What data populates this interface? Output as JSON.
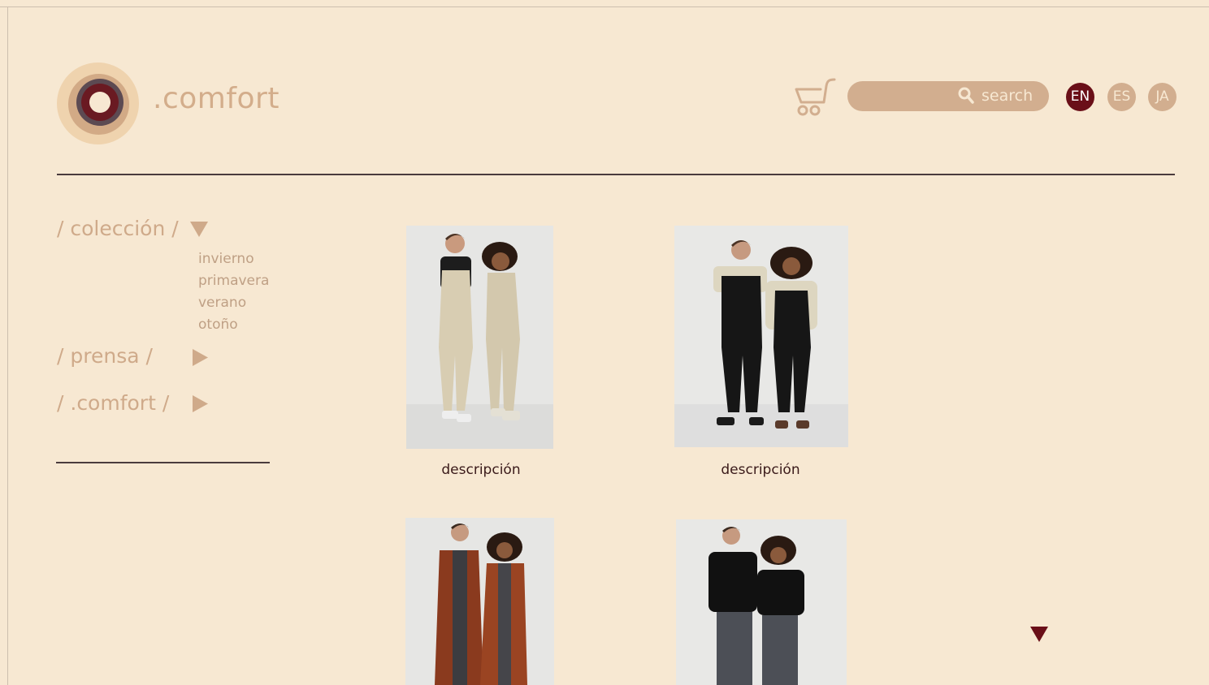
{
  "brand": {
    "name": ".comfort"
  },
  "header": {
    "search_placeholder": "search",
    "languages": [
      "EN",
      "ES",
      "JA"
    ],
    "active_language": "EN"
  },
  "nav": {
    "sections": [
      {
        "label": "/ colección /",
        "expanded": true,
        "items": [
          "invierno",
          "primavera",
          "verano",
          "otoño"
        ]
      },
      {
        "label": "/ prensa /",
        "expanded": false
      },
      {
        "label": "/ .comfort /",
        "expanded": false
      }
    ]
  },
  "products": [
    {
      "description": "descripción"
    },
    {
      "description": "descripción"
    },
    {
      "description": ""
    },
    {
      "description": ""
    }
  ],
  "colors": {
    "background": "#f7e8d2",
    "accent": "#6a0f18",
    "muted": "#d2ae8f",
    "nav_text": "#cfaa8a"
  },
  "icons": [
    "logo-icon",
    "cart-icon",
    "search-icon",
    "triangle-down-icon",
    "triangle-right-icon"
  ]
}
